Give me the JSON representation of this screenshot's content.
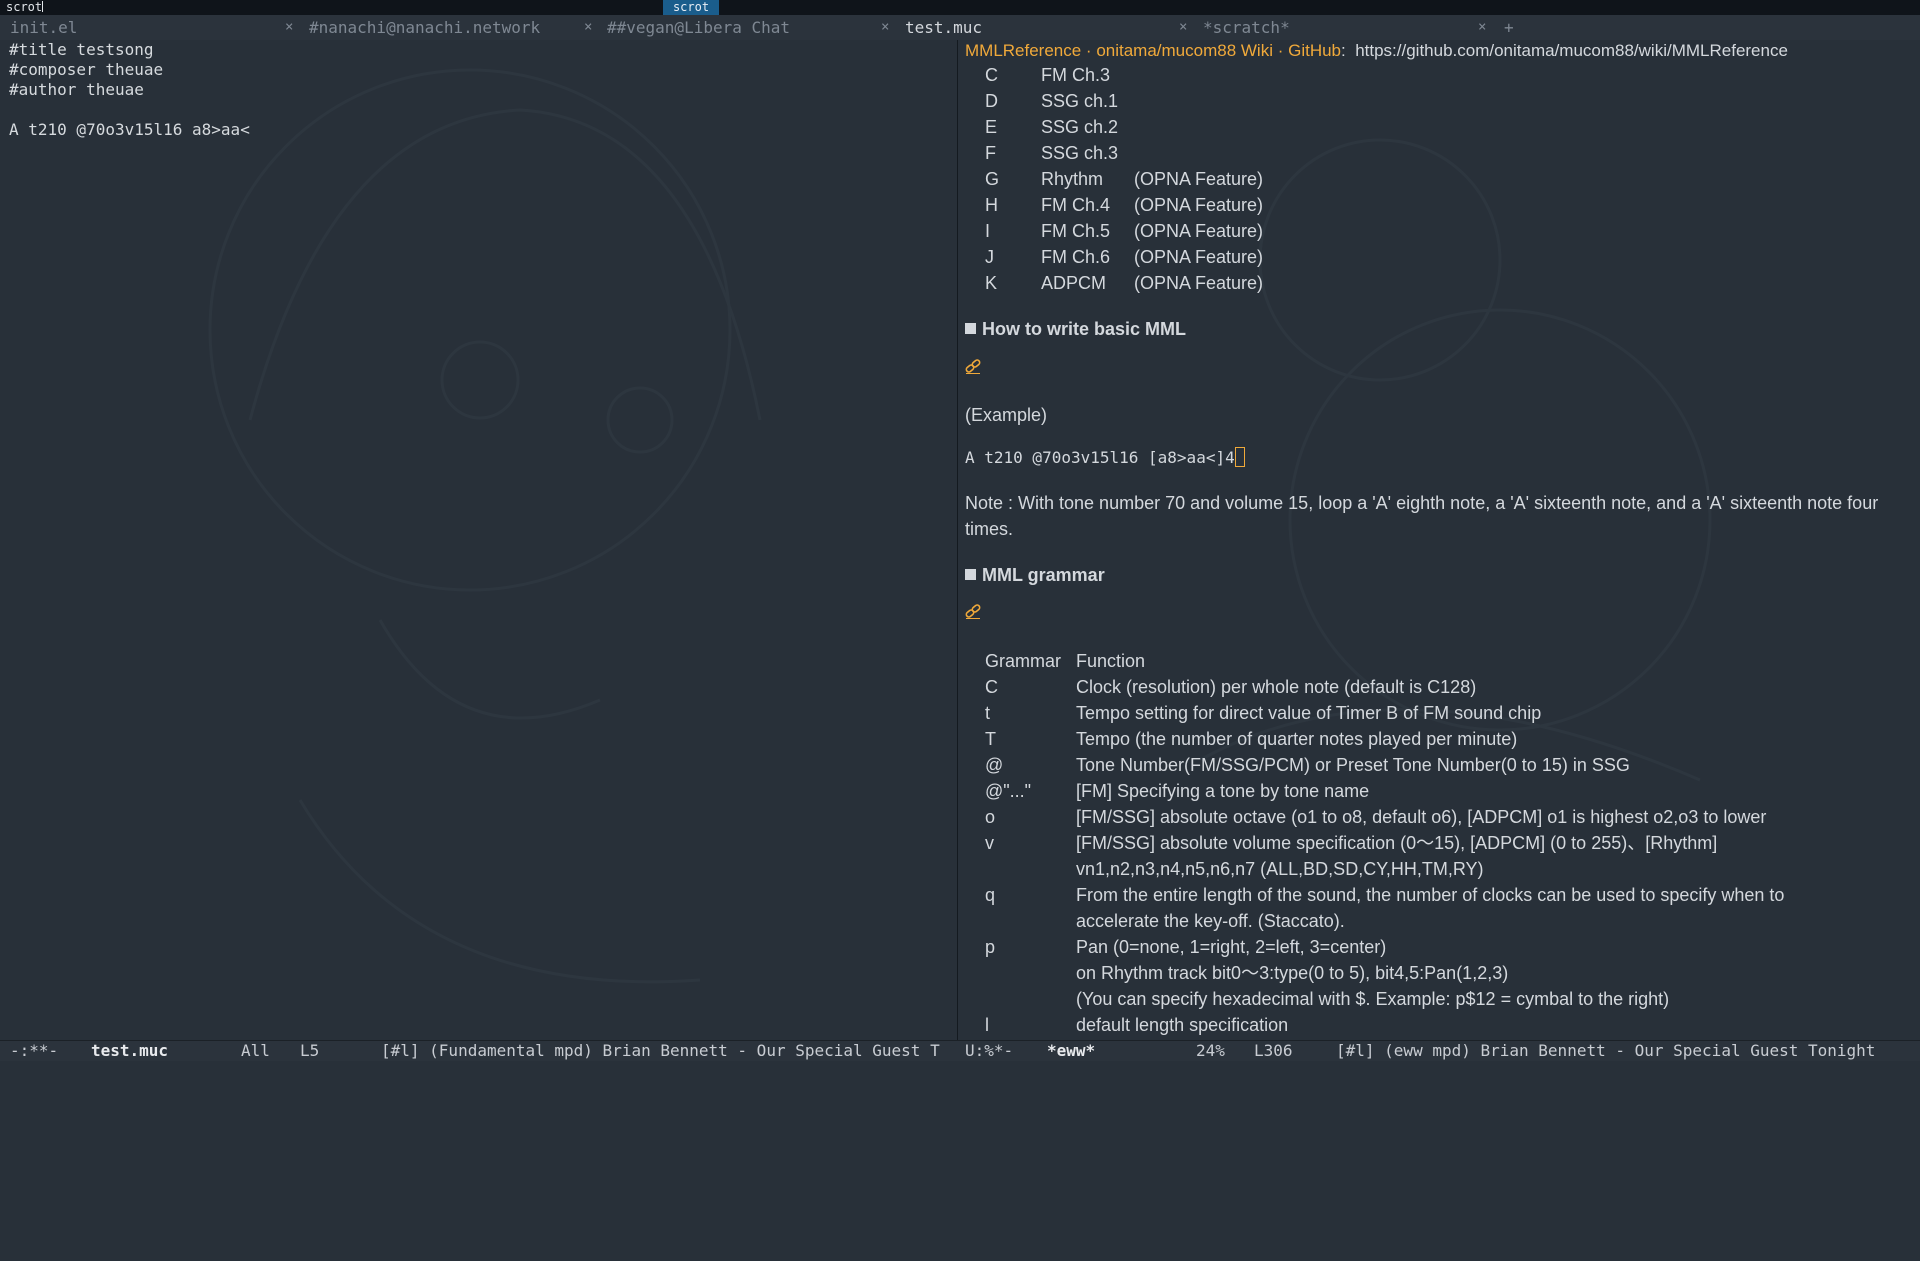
{
  "topbar": {
    "left_text": "scrot",
    "center_label": "scrot"
  },
  "tabs": [
    {
      "label": "init.el",
      "active": false
    },
    {
      "label": "#nanachi@nanachi.network",
      "active": false
    },
    {
      "label": "##vegan@Libera Chat",
      "active": false
    },
    {
      "label": "test.muc",
      "active": true
    },
    {
      "label": "*scratch*",
      "active": false
    }
  ],
  "tab_close_glyph": "×",
  "tab_add_glyph": "+",
  "left_buffer": {
    "lines": [
      "#title testsong",
      "#composer theuae",
      "#author theuae",
      "",
      "A t210 @70o3v15l16 a8>aa<"
    ]
  },
  "eww": {
    "page_title": "MMLReference · onitama/mucom88 Wiki · GitHub",
    "url": "https://github.com/onitama/mucom88/wiki/MMLReference",
    "channels": [
      {
        "key": "C",
        "name": "FM Ch.3",
        "note": ""
      },
      {
        "key": "D",
        "name": "SSG ch.1",
        "note": ""
      },
      {
        "key": "E",
        "name": "SSG ch.2",
        "note": ""
      },
      {
        "key": "F",
        "name": "SSG ch.3",
        "note": ""
      },
      {
        "key": "G",
        "name": "Rhythm",
        "note": "(OPNA Feature)"
      },
      {
        "key": "H",
        "name": "FM Ch.4",
        "note": "(OPNA Feature)"
      },
      {
        "key": "I",
        "name": "FM Ch.5",
        "note": "(OPNA Feature)"
      },
      {
        "key": "J",
        "name": "FM Ch.6",
        "note": "(OPNA Feature)"
      },
      {
        "key": "K",
        "name": "ADPCM",
        "note": "(OPNA Feature)"
      }
    ],
    "heading_basic": "How to write basic MML",
    "example_label": "(Example)",
    "example_code": "A t210 @70o3v15l16 [a8>aa<]4",
    "note_text": "Note : With tone number 70 and volume 15, loop a 'A' eighth note, a 'A' sixteenth note, and a 'A' sixteenth note four times.",
    "heading_grammar": "MML grammar",
    "grammar_header": {
      "key": "Grammar",
      "fn": "Function"
    },
    "grammar": [
      {
        "key": "C",
        "lines": [
          "Clock (resolution) per whole note (default is C128)"
        ]
      },
      {
        "key": "t",
        "lines": [
          "Tempo setting for direct value of Timer B of FM sound chip"
        ]
      },
      {
        "key": "T",
        "lines": [
          "Tempo (the number of quarter notes played per minute)"
        ]
      },
      {
        "key": "@",
        "lines": [
          "Tone Number(FM/SSG/PCM) or Preset Tone Number(0 to 15) in SSG"
        ]
      },
      {
        "key": "@\"...\"",
        "lines": [
          "[FM] Specifying a tone by tone name"
        ]
      },
      {
        "key": "o",
        "lines": [
          "[FM/SSG] absolute octave (o1 to o8, default o6), [ADPCM] o1 is highest o2,o3 to lower"
        ]
      },
      {
        "key": "v",
        "lines": [
          "[FM/SSG] absolute volume specification (0～15), [ADPCM] (0 to 255)、[Rhythm]",
          "vn1,n2,n3,n4,n5,n6,n7 (ALL,BD,SD,CY,HH,TM,RY)"
        ]
      },
      {
        "key": "q",
        "lines": [
          "From the entire length of the sound, the number of clocks can be used to specify when to",
          "accelerate the key-off. (Staccato)."
        ]
      },
      {
        "key": "p",
        "lines": [
          "Pan (0=none, 1=right, 2=left, 3=center)",
          "on Rhythm track bit0～3:type(0 to 5), bit4,5:Pan(1,2,3)",
          "(You can specify hexadecimal with $. Example: p$12 = cymbal to the right)"
        ]
      },
      {
        "key": "l",
        "lines": [
          "default length specification"
        ]
      }
    ]
  },
  "modeline": {
    "left_state": "-:**-",
    "left_buffer": "test.muc",
    "left_pos": "All",
    "left_line": "L5",
    "left_info": "[#l] (Fundamental mpd) Brian Bennett - Our Special Guest T",
    "right_state": "U:%*-",
    "right_buffer": "*eww*",
    "right_pos": "24%",
    "right_line": "L306",
    "right_info": "[#l] (eww mpd) Brian Bennett - Our Special Guest Tonight"
  },
  "colors": {
    "background": "#283039",
    "accent_orange": "#f0a93a",
    "topbar_highlight": "#1a5d8c"
  }
}
